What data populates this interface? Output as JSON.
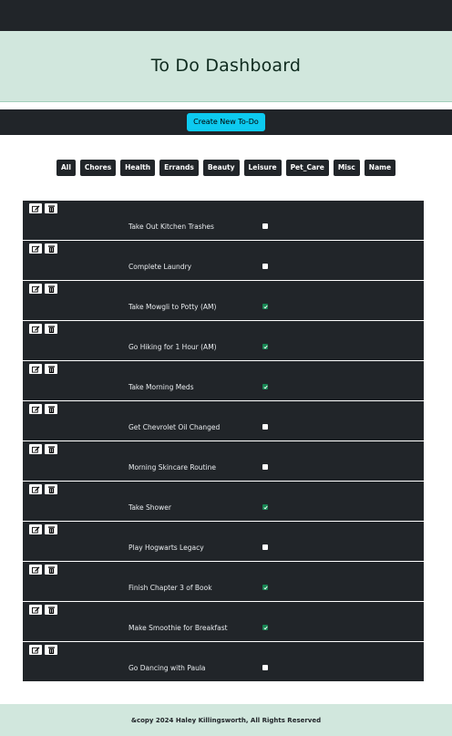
{
  "header": {
    "title": "To Do Dashboard"
  },
  "toolbar": {
    "create_label": "Create New To-Do"
  },
  "filters": [
    "All",
    "Chores",
    "Health",
    "Errands",
    "Beauty",
    "Leisure",
    "Pet_Care",
    "Misc",
    "Name"
  ],
  "todos": [
    {
      "title": "Take Out Kitchen Trashes",
      "completed": false
    },
    {
      "title": "Complete Laundry",
      "completed": false
    },
    {
      "title": "Take Mowgli to Potty (AM)",
      "completed": true
    },
    {
      "title": "Go Hiking for 1 Hour (AM)",
      "completed": true
    },
    {
      "title": "Take Morning Meds",
      "completed": true
    },
    {
      "title": "Get Chevrolet Oil Changed",
      "completed": false
    },
    {
      "title": "Morning Skincare Routine",
      "completed": false
    },
    {
      "title": "Take Shower",
      "completed": true
    },
    {
      "title": "Play Hogwarts Legacy",
      "completed": false
    },
    {
      "title": "Finish Chapter 3 of Book",
      "completed": true
    },
    {
      "title": "Make Smoothie for Breakfast",
      "completed": true
    },
    {
      "title": "Go Dancing with Paula",
      "completed": false
    }
  ],
  "icons": {
    "edit": "edit-icon",
    "delete": "trash-icon",
    "check": "checkmark-icon"
  },
  "colors": {
    "accent": "#0dcaf0",
    "dark": "#212529",
    "banner": "#d1e7dd",
    "done": "#198754"
  },
  "footer": {
    "text": "&copy 2024 Haley Killingsworth, All Rights Reserved"
  }
}
